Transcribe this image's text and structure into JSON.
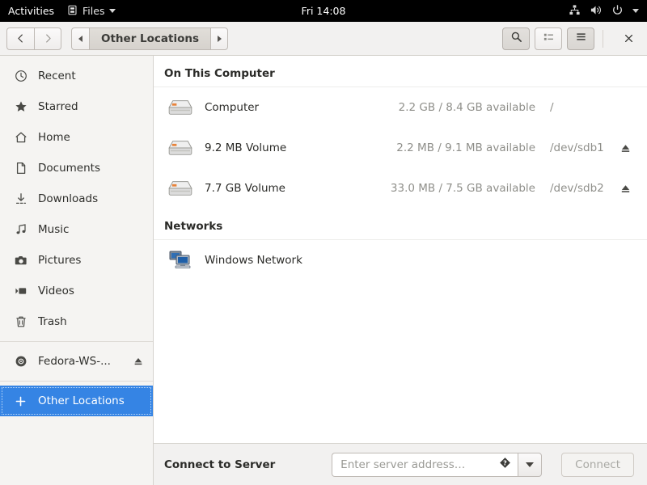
{
  "topbar": {
    "activities": "Activities",
    "app_menu": {
      "label": "Files",
      "icon": "files-app-icon"
    },
    "clock": "Fri 14:08",
    "tray": [
      {
        "name": "network-icon"
      },
      {
        "name": "volume-icon"
      },
      {
        "name": "power-icon"
      },
      {
        "name": "chevron-down-icon"
      }
    ]
  },
  "headerbar": {
    "back_icon": "chevron-left-icon",
    "forward_icon": "chevron-right-icon",
    "breadcrumb": {
      "scroll_left_icon": "triangle-left-icon",
      "label": "Other Locations",
      "scroll_right_icon": "triangle-right-icon"
    },
    "search_icon": "search-icon",
    "view_list_icon": "list-view-icon",
    "menu_icon": "hamburger-menu-icon",
    "close_icon": "close-icon"
  },
  "sidebar": {
    "items": [
      {
        "label": "Recent",
        "icon": "clock-icon",
        "selected": false,
        "eject": false
      },
      {
        "label": "Starred",
        "icon": "star-icon",
        "selected": false,
        "eject": false
      },
      {
        "label": "Home",
        "icon": "home-icon",
        "selected": false,
        "eject": false
      },
      {
        "label": "Documents",
        "icon": "document-icon",
        "selected": false,
        "eject": false
      },
      {
        "label": "Downloads",
        "icon": "download-icon",
        "selected": false,
        "eject": false
      },
      {
        "label": "Music",
        "icon": "music-icon",
        "selected": false,
        "eject": false
      },
      {
        "label": "Pictures",
        "icon": "camera-icon",
        "selected": false,
        "eject": false
      },
      {
        "label": "Videos",
        "icon": "video-icon",
        "selected": false,
        "eject": false
      },
      {
        "label": "Trash",
        "icon": "trash-icon",
        "selected": false,
        "eject": false
      },
      {
        "label": "Fedora-WS-...",
        "icon": "disc-icon",
        "selected": false,
        "eject": true
      },
      {
        "label": "Other Locations",
        "icon": "plus-icon",
        "selected": true,
        "eject": false
      }
    ],
    "selected_color": "#3584e4"
  },
  "content": {
    "sections": [
      {
        "title": "On This Computer",
        "rows": [
          {
            "name": "Computer",
            "icon": "hard-drive-icon",
            "size": "2.2 GB / 8.4 GB available",
            "device": "/",
            "eject": false
          },
          {
            "name": "9.2 MB Volume",
            "icon": "hard-drive-icon",
            "size": "2.2 MB / 9.1 MB available",
            "device": "/dev/sdb1",
            "eject": true
          },
          {
            "name": "7.7 GB Volume",
            "icon": "hard-drive-icon",
            "size": "33.0 MB / 7.5 GB available",
            "device": "/dev/sdb2",
            "eject": true
          }
        ]
      },
      {
        "title": "Networks",
        "rows": [
          {
            "name": "Windows Network",
            "icon": "windows-network-icon",
            "size": "",
            "device": "",
            "eject": false
          }
        ]
      }
    ]
  },
  "connect_bar": {
    "title": "Connect to Server",
    "placeholder": "Enter server address…",
    "value": "",
    "help_icon": "help-icon",
    "dropdown_icon": "chevron-down-icon",
    "button_label": "Connect",
    "button_enabled": false
  }
}
